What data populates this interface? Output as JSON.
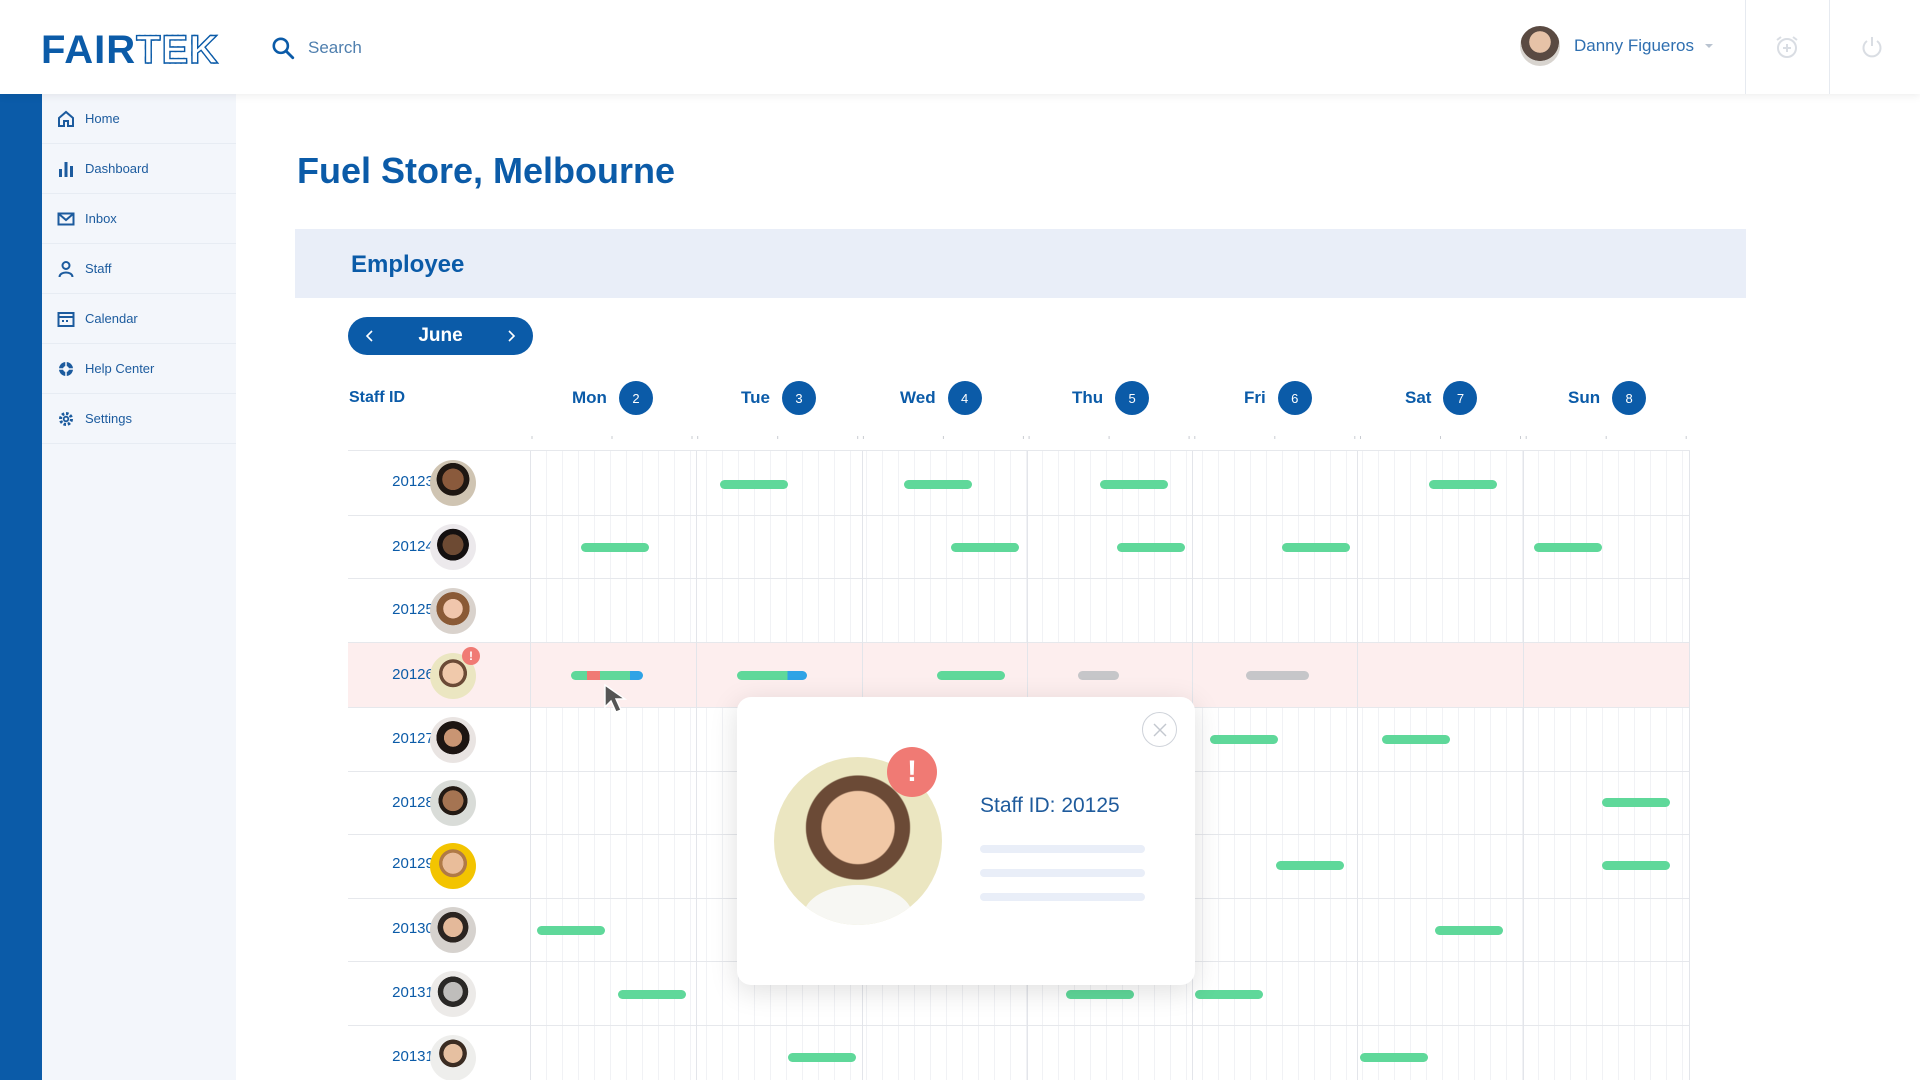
{
  "app": {
    "logo_fair": "FAIR",
    "logo_tek": "TEK"
  },
  "search": {
    "label": "Search"
  },
  "user": {
    "name": "Danny Figueros"
  },
  "icons": {
    "search": "search-icon",
    "alarm": "alarm-add-icon",
    "power": "power-icon",
    "chevron": "chevron-down-icon",
    "close": "close-icon"
  },
  "sidebar": {
    "items": [
      {
        "label": "Home",
        "icon": "home-icon"
      },
      {
        "label": "Dashboard",
        "icon": "bar-chart-icon"
      },
      {
        "label": "Inbox",
        "icon": "mail-icon"
      },
      {
        "label": "Staff",
        "icon": "person-icon"
      },
      {
        "label": "Calendar",
        "icon": "calendar-icon"
      },
      {
        "label": "Help Center",
        "icon": "lifebuoy-icon"
      },
      {
        "label": "Settings",
        "icon": "gear-icon"
      }
    ]
  },
  "page": {
    "title": "Fuel Store, Melbourne",
    "section": "Employee"
  },
  "schedule": {
    "month": "June",
    "staff_header": "Staff ID",
    "days": [
      {
        "name": "Mon",
        "num": "2"
      },
      {
        "name": "Tue",
        "num": "3"
      },
      {
        "name": "Wed",
        "num": "4"
      },
      {
        "name": "Thu",
        "num": "5"
      },
      {
        "name": "Fri",
        "num": "6"
      },
      {
        "name": "Sat",
        "num": "7"
      },
      {
        "name": "Sun",
        "num": "8"
      }
    ],
    "staff": [
      {
        "id": "20123"
      },
      {
        "id": "20124"
      },
      {
        "id": "20125"
      },
      {
        "id": "20126",
        "alert": "!",
        "highlight": true
      },
      {
        "id": "20127"
      },
      {
        "id": "20128"
      },
      {
        "id": "20129"
      },
      {
        "id": "20130"
      },
      {
        "id": "20131"
      },
      {
        "id": "20131"
      }
    ]
  },
  "colors": {
    "primary": "#0b5ba8",
    "shift": "#5fd89a",
    "shift_inactive": "#c6c6c9",
    "alert": "#f07a74",
    "split_red": "#f07a74",
    "split_blue": "#2fa3e6",
    "highlight_row": "#fdeeee"
  },
  "popup": {
    "title": "Staff ID: 20125",
    "alert": "!"
  }
}
